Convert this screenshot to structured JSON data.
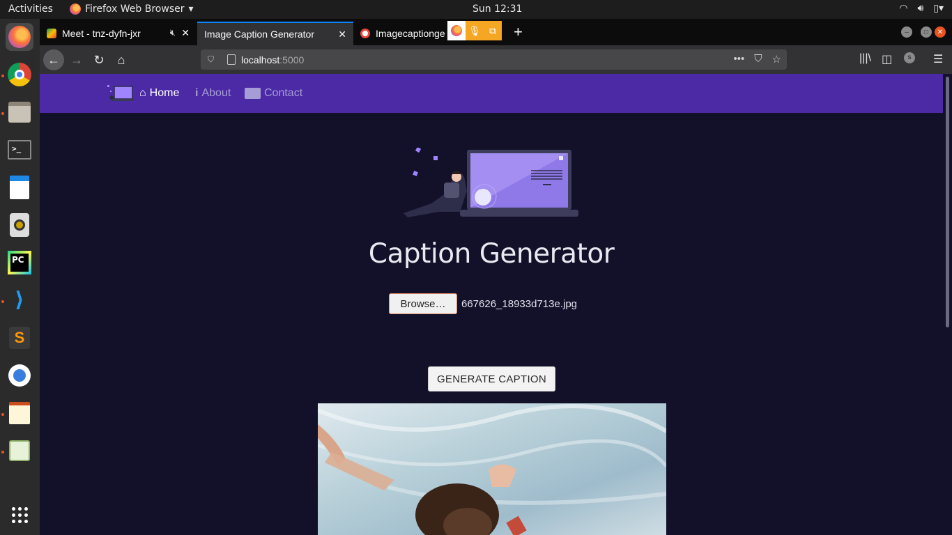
{
  "system": {
    "activities": "Activities",
    "app_name": "Firefox Web Browser",
    "clock": "Sun 12:31"
  },
  "browser": {
    "tabs": [
      {
        "title": "Meet - tnz-dyfn-jxr"
      },
      {
        "title": "Image Caption Generator"
      },
      {
        "title": "Imagecaptionge"
      }
    ],
    "url_host": "localhost",
    "url_port": ":5000"
  },
  "site": {
    "nav": {
      "home": "Home",
      "about": "About",
      "contact": "Contact"
    },
    "title": "Caption Generator",
    "browse_label": "Browse…",
    "file_name": "667626_18933d713e.jpg",
    "generate_label": "GENERATE CAPTION"
  },
  "colors": {
    "page_bg": "#121129",
    "nav_bg": "#4c2aa6",
    "accent": "#a084ff"
  }
}
